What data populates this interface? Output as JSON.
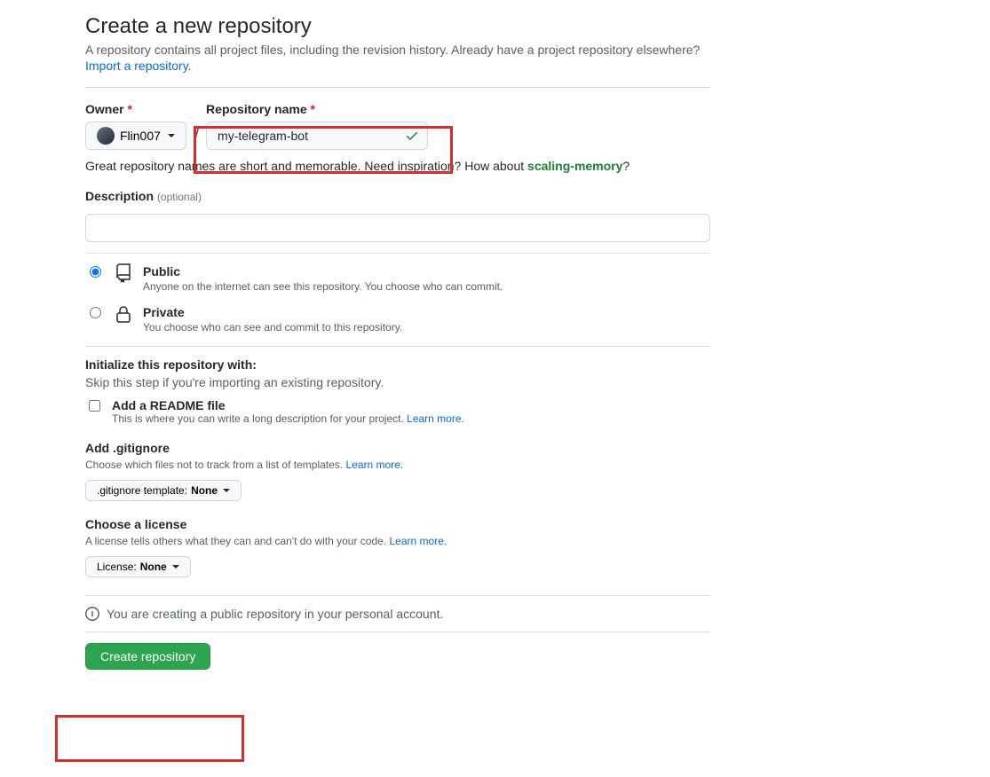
{
  "header": {
    "title": "Create a new repository",
    "subhead": "A repository contains all project files, including the revision history. Already have a project repository elsewhere?",
    "import_link": "Import a repository."
  },
  "owner": {
    "label": "Owner",
    "name": "Flin007"
  },
  "repo": {
    "label": "Repository name",
    "value": "my-telegram-bot"
  },
  "hint": {
    "prefix": "Great repository names are short and memorable. Need inspiration? How about ",
    "suggestion": "scaling-memory",
    "suffix": "?"
  },
  "description": {
    "label": "Description",
    "optional": "(optional)"
  },
  "visibility": {
    "public": {
      "title": "Public",
      "sub": "Anyone on the internet can see this repository. You choose who can commit."
    },
    "private": {
      "title": "Private",
      "sub": "You choose who can see and commit to this repository."
    }
  },
  "init": {
    "title": "Initialize this repository with:",
    "sub": "Skip this step if you're importing an existing repository.",
    "readme": {
      "title": "Add a README file",
      "sub_prefix": "This is where you can write a long description for your project. ",
      "learn": "Learn more."
    },
    "gitignore": {
      "title": "Add .gitignore",
      "sub_prefix": "Choose which files not to track from a list of templates. ",
      "learn": "Learn more.",
      "button_prefix": ".gitignore template: ",
      "button_value": "None"
    },
    "license": {
      "title": "Choose a license",
      "sub_prefix": "A license tells others what they can and can't do with your code. ",
      "learn": "Learn more.",
      "button_prefix": "License: ",
      "button_value": "None"
    }
  },
  "info": "You are creating a public repository in your personal account.",
  "submit": "Create repository"
}
